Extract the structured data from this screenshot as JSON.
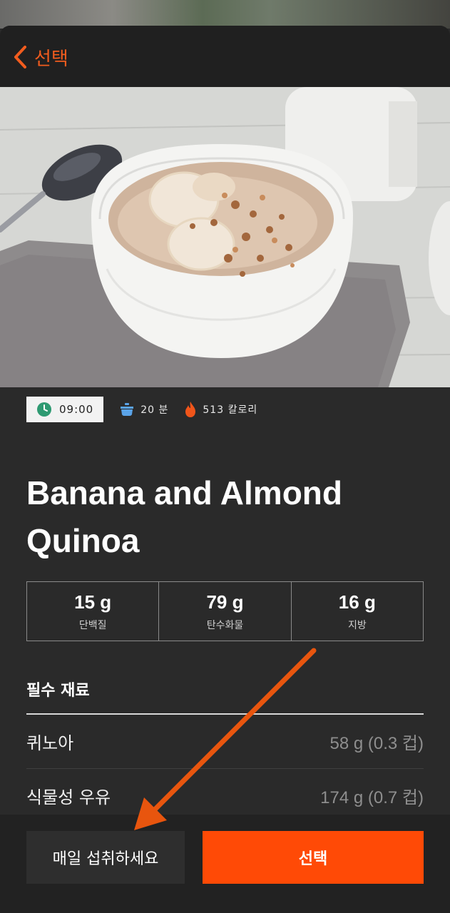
{
  "header": {
    "back_label": "선택"
  },
  "recipe": {
    "time": "09:00",
    "duration": "20 분",
    "calories": "513 칼로리",
    "title": "Banana and Almond Quinoa"
  },
  "macros": [
    {
      "value": "15 g",
      "label": "단백질"
    },
    {
      "value": "79 g",
      "label": "탄수화물"
    },
    {
      "value": "16 g",
      "label": "지방"
    }
  ],
  "ingredients": {
    "title": "필수 재료",
    "items": [
      {
        "name": "퀴노아",
        "amount": "58 g (0.3 컵)"
      },
      {
        "name": "식물성 우유",
        "amount": "174 g (0.7 컵)"
      }
    ]
  },
  "actions": {
    "daily_label": "매일 섭취하세요",
    "select_label": "선택"
  },
  "colors": {
    "accent": "#ff4a06",
    "annotation_arrow": "#e8550e",
    "background": "#2a2a2a"
  }
}
